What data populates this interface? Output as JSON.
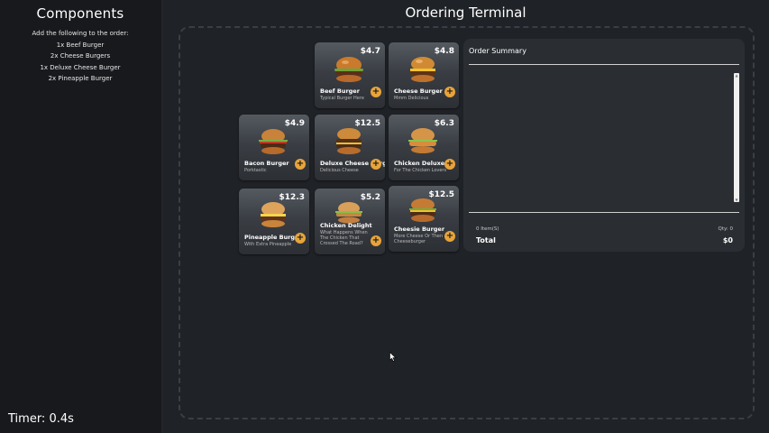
{
  "sidebar": {
    "title": "Components",
    "instructions": [
      "Add the following to the order:",
      "1x Beef Burger",
      "2x Cheese Burgers",
      "1x Deluxe Cheese Burger",
      "2x Pineapple Burger"
    ],
    "timer": "Timer: 0.4s"
  },
  "main": {
    "title": "Ordering Terminal"
  },
  "menu": [
    {
      "price": "$4.7",
      "name": "Beef Burger",
      "desc": "Typical Burger Here"
    },
    {
      "price": "$4.8",
      "name": "Cheese Burger",
      "desc": "Mmm Delicious"
    },
    {
      "price": "$4.9",
      "name": "Bacon Burger",
      "desc": "Porktastic"
    },
    {
      "price": "$12.5",
      "name": "Deluxe Cheese Burger",
      "desc": "Delicious Cheese"
    },
    {
      "price": "$6.3",
      "name": "Chicken Deluxe",
      "desc": "For The Chicken Lovers"
    },
    {
      "price": "$12.3",
      "name": "Pineapple Burger",
      "desc": "With Extra Pineapple"
    },
    {
      "price": "$5.2",
      "name": "Chicken Delight",
      "desc": "What Happens When The Chicken That Crossed The Road?"
    },
    {
      "price": "$12.5",
      "name": "Cheesie Burger",
      "desc": "More Cheese Or Then Cheeseburger"
    }
  ],
  "add_label": "+",
  "summary": {
    "title": "Order Summary",
    "item_count": "0 Item(S)",
    "qty": "Qty: 0",
    "total_label": "Total",
    "total_value": "$0"
  },
  "colors": {
    "accent": "#e8a43a",
    "panel": "#2a2e33",
    "background": "#17191c"
  }
}
